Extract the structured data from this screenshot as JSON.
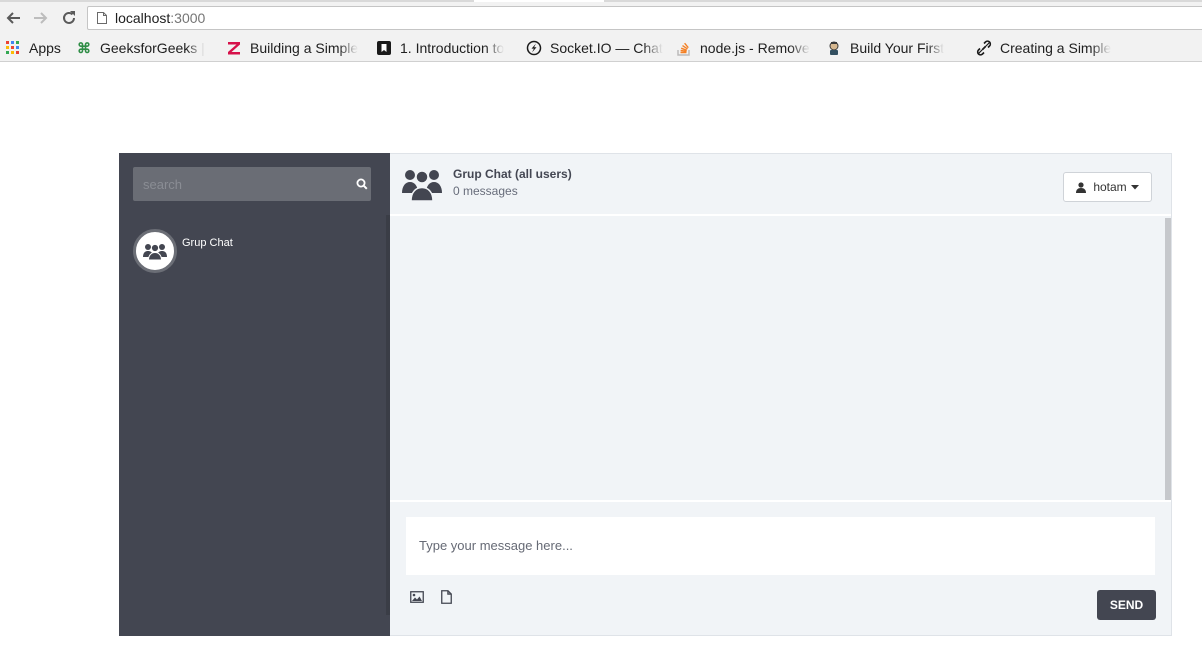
{
  "browser": {
    "url_host": "localhost",
    "url_port": ":3000",
    "bookmarks": [
      {
        "label": "Apps",
        "icon": "apps-grid-icon"
      },
      {
        "label": "GeeksforGeeks |",
        "icon": "geeksforgeeks-icon"
      },
      {
        "label": "Building a Simple",
        "icon": "zapier-z-icon"
      },
      {
        "label": "1. Introduction to",
        "icon": "bookmark-icon"
      },
      {
        "label": "Socket.IO — Chat",
        "icon": "socketio-icon"
      },
      {
        "label": "node.js - Remove",
        "icon": "stackoverflow-icon"
      },
      {
        "label": "Build Your First",
        "icon": "jenkins-icon"
      },
      {
        "label": "Creating a Simple",
        "icon": "link-icon"
      }
    ]
  },
  "sidebar": {
    "search_placeholder": "search",
    "contacts": [
      {
        "name": "Grup Chat",
        "icon": "users-icon"
      }
    ]
  },
  "chat": {
    "title": "Grup Chat (all users)",
    "message_count": "0 messages",
    "user_menu_label": "hotam",
    "compose_placeholder": "Type your message here...",
    "send_label": "SEND"
  },
  "colors": {
    "sidebar_bg": "#434651",
    "main_bg": "#f1f4f7",
    "send_button_bg": "#434651"
  }
}
